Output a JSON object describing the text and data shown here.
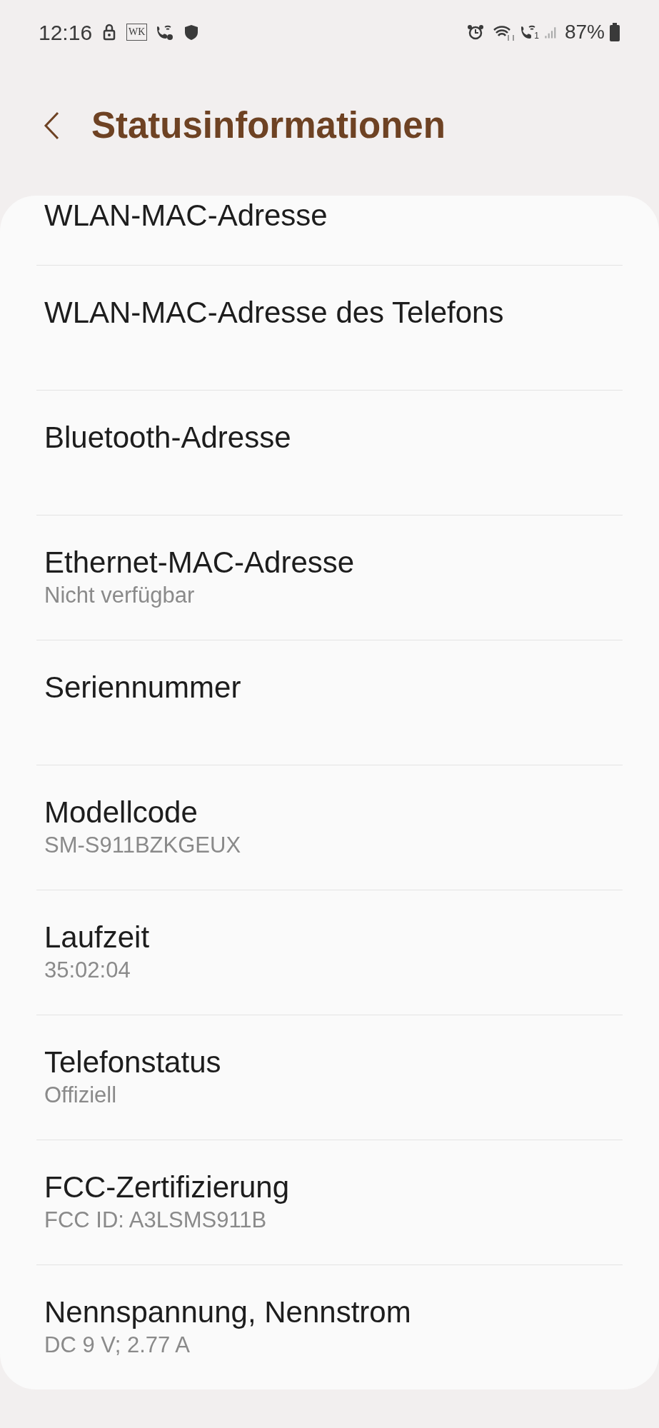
{
  "status_bar": {
    "time": "12:16",
    "wk_label": "WK",
    "battery": "87%",
    "sim_label": "1"
  },
  "header": {
    "title": "Statusinformationen"
  },
  "items": [
    {
      "title": "WLAN-MAC-Adresse",
      "partial": true
    },
    {
      "title": "WLAN-MAC-Adresse des Telefons"
    },
    {
      "title": "Bluetooth-Adresse"
    },
    {
      "title": "Ethernet-MAC-Adresse",
      "value": "Nicht verfügbar"
    },
    {
      "title": "Seriennummer"
    },
    {
      "title": "Modellcode",
      "value": "SM-S911BZKGEUX"
    },
    {
      "title": "Laufzeit",
      "value": "35:02:04"
    },
    {
      "title": "Telefonstatus",
      "value": "Offiziell"
    },
    {
      "title": "FCC-Zertifizierung",
      "value": "FCC ID: A3LSMS911B"
    },
    {
      "title": "Nennspannung, Nennstrom",
      "value": "DC 9 V; 2.77 A"
    }
  ]
}
